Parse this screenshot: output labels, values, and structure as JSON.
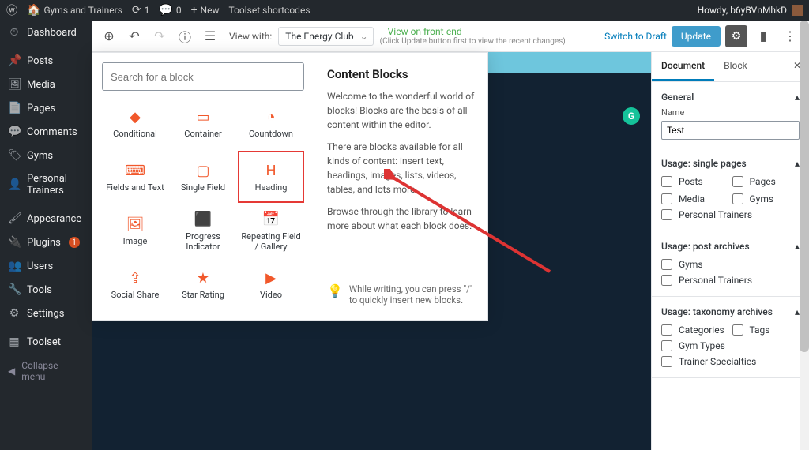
{
  "admin_bar": {
    "site_name": "Gyms and Trainers",
    "updates": "1",
    "comments": "0",
    "new": "New",
    "shortcodes": "Toolset shortcodes",
    "howdy": "Howdy, b6yBVnMhkD"
  },
  "sidebar": {
    "items": [
      {
        "icon": "⏱",
        "label": "Dashboard"
      },
      {
        "icon": "📌",
        "label": "Posts"
      },
      {
        "icon": "🖼",
        "label": "Media"
      },
      {
        "icon": "📄",
        "label": "Pages"
      },
      {
        "icon": "💬",
        "label": "Comments"
      },
      {
        "icon": "🏷",
        "label": "Gyms"
      },
      {
        "icon": "👤",
        "label": "Personal Trainers"
      },
      {
        "icon": "🖌",
        "label": "Appearance"
      },
      {
        "icon": "🔌",
        "label": "Plugins",
        "badge": "1"
      },
      {
        "icon": "👥",
        "label": "Users"
      },
      {
        "icon": "🔧",
        "label": "Tools"
      },
      {
        "icon": "⚙",
        "label": "Settings"
      },
      {
        "icon": "▦",
        "label": "Toolset"
      }
    ],
    "collapse": "Collapse menu"
  },
  "toolbar": {
    "view_with": "View with:",
    "view_value": "The Energy Club",
    "front_link": "View on front-end",
    "front_sub": "(Click Update button first to view the recent changes)",
    "draft": "Switch to Draft",
    "update": "Update"
  },
  "inserter": {
    "search_placeholder": "Search for a block",
    "title": "Content Blocks",
    "para1": "Welcome to the wonderful world of blocks! Blocks are the basis of all content within the editor.",
    "para2": "There are blocks available for all kinds of content: insert text, headings, images, lists, videos, tables, and lots more.",
    "para3": "Browse through the library to learn more about what each block does.",
    "tip": "While writing, you can press \"/\" to quickly insert new blocks.",
    "blocks": [
      {
        "icon": "◆",
        "label": "Conditional"
      },
      {
        "icon": "▭",
        "label": "Container"
      },
      {
        "icon": "◔",
        "label": "Countdown"
      },
      {
        "icon": "⌨",
        "label": "Fields and Text"
      },
      {
        "icon": "▢",
        "label": "Single Field"
      },
      {
        "icon": "H",
        "label": "Heading",
        "highlight": true
      },
      {
        "icon": "🖼",
        "label": "Image"
      },
      {
        "icon": "⬛",
        "label": "Progress Indicator"
      },
      {
        "icon": "📅",
        "label": "Repeating Field / Gallery"
      },
      {
        "icon": "⇪",
        "label": "Social Share"
      },
      {
        "icon": "★",
        "label": "Star Rating"
      },
      {
        "icon": "▶",
        "label": "Video"
      }
    ]
  },
  "right": {
    "tabs": {
      "doc": "Document",
      "block": "Block"
    },
    "general": {
      "title": "General",
      "name_label": "Name",
      "name_value": "Test"
    },
    "usage_single": {
      "title": "Usage: single pages",
      "items": [
        "Posts",
        "Pages",
        "Media",
        "Gyms",
        "Personal Trainers"
      ]
    },
    "usage_post": {
      "title": "Usage: post archives",
      "items": [
        "Gyms",
        "Personal Trainers"
      ]
    },
    "usage_tax": {
      "title": "Usage: taxonomy archives",
      "items": [
        "Categories",
        "Tags",
        "Gym Types",
        "Trainer Specialties"
      ]
    }
  }
}
